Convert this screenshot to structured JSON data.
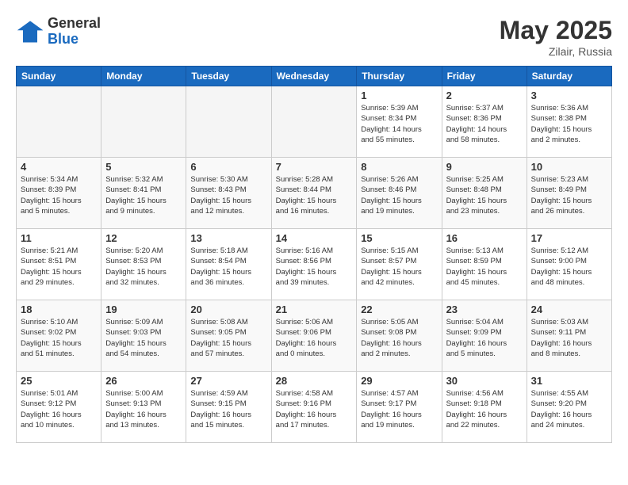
{
  "header": {
    "logo_general": "General",
    "logo_blue": "Blue",
    "month_year": "May 2025",
    "location": "Zilair, Russia"
  },
  "weekdays": [
    "Sunday",
    "Monday",
    "Tuesday",
    "Wednesday",
    "Thursday",
    "Friday",
    "Saturday"
  ],
  "weeks": [
    [
      {
        "day": "",
        "info": ""
      },
      {
        "day": "",
        "info": ""
      },
      {
        "day": "",
        "info": ""
      },
      {
        "day": "",
        "info": ""
      },
      {
        "day": "1",
        "info": "Sunrise: 5:39 AM\nSunset: 8:34 PM\nDaylight: 14 hours\nand 55 minutes."
      },
      {
        "day": "2",
        "info": "Sunrise: 5:37 AM\nSunset: 8:36 PM\nDaylight: 14 hours\nand 58 minutes."
      },
      {
        "day": "3",
        "info": "Sunrise: 5:36 AM\nSunset: 8:38 PM\nDaylight: 15 hours\nand 2 minutes."
      }
    ],
    [
      {
        "day": "4",
        "info": "Sunrise: 5:34 AM\nSunset: 8:39 PM\nDaylight: 15 hours\nand 5 minutes."
      },
      {
        "day": "5",
        "info": "Sunrise: 5:32 AM\nSunset: 8:41 PM\nDaylight: 15 hours\nand 9 minutes."
      },
      {
        "day": "6",
        "info": "Sunrise: 5:30 AM\nSunset: 8:43 PM\nDaylight: 15 hours\nand 12 minutes."
      },
      {
        "day": "7",
        "info": "Sunrise: 5:28 AM\nSunset: 8:44 PM\nDaylight: 15 hours\nand 16 minutes."
      },
      {
        "day": "8",
        "info": "Sunrise: 5:26 AM\nSunset: 8:46 PM\nDaylight: 15 hours\nand 19 minutes."
      },
      {
        "day": "9",
        "info": "Sunrise: 5:25 AM\nSunset: 8:48 PM\nDaylight: 15 hours\nand 23 minutes."
      },
      {
        "day": "10",
        "info": "Sunrise: 5:23 AM\nSunset: 8:49 PM\nDaylight: 15 hours\nand 26 minutes."
      }
    ],
    [
      {
        "day": "11",
        "info": "Sunrise: 5:21 AM\nSunset: 8:51 PM\nDaylight: 15 hours\nand 29 minutes."
      },
      {
        "day": "12",
        "info": "Sunrise: 5:20 AM\nSunset: 8:53 PM\nDaylight: 15 hours\nand 32 minutes."
      },
      {
        "day": "13",
        "info": "Sunrise: 5:18 AM\nSunset: 8:54 PM\nDaylight: 15 hours\nand 36 minutes."
      },
      {
        "day": "14",
        "info": "Sunrise: 5:16 AM\nSunset: 8:56 PM\nDaylight: 15 hours\nand 39 minutes."
      },
      {
        "day": "15",
        "info": "Sunrise: 5:15 AM\nSunset: 8:57 PM\nDaylight: 15 hours\nand 42 minutes."
      },
      {
        "day": "16",
        "info": "Sunrise: 5:13 AM\nSunset: 8:59 PM\nDaylight: 15 hours\nand 45 minutes."
      },
      {
        "day": "17",
        "info": "Sunrise: 5:12 AM\nSunset: 9:00 PM\nDaylight: 15 hours\nand 48 minutes."
      }
    ],
    [
      {
        "day": "18",
        "info": "Sunrise: 5:10 AM\nSunset: 9:02 PM\nDaylight: 15 hours\nand 51 minutes."
      },
      {
        "day": "19",
        "info": "Sunrise: 5:09 AM\nSunset: 9:03 PM\nDaylight: 15 hours\nand 54 minutes."
      },
      {
        "day": "20",
        "info": "Sunrise: 5:08 AM\nSunset: 9:05 PM\nDaylight: 15 hours\nand 57 minutes."
      },
      {
        "day": "21",
        "info": "Sunrise: 5:06 AM\nSunset: 9:06 PM\nDaylight: 16 hours\nand 0 minutes."
      },
      {
        "day": "22",
        "info": "Sunrise: 5:05 AM\nSunset: 9:08 PM\nDaylight: 16 hours\nand 2 minutes."
      },
      {
        "day": "23",
        "info": "Sunrise: 5:04 AM\nSunset: 9:09 PM\nDaylight: 16 hours\nand 5 minutes."
      },
      {
        "day": "24",
        "info": "Sunrise: 5:03 AM\nSunset: 9:11 PM\nDaylight: 16 hours\nand 8 minutes."
      }
    ],
    [
      {
        "day": "25",
        "info": "Sunrise: 5:01 AM\nSunset: 9:12 PM\nDaylight: 16 hours\nand 10 minutes."
      },
      {
        "day": "26",
        "info": "Sunrise: 5:00 AM\nSunset: 9:13 PM\nDaylight: 16 hours\nand 13 minutes."
      },
      {
        "day": "27",
        "info": "Sunrise: 4:59 AM\nSunset: 9:15 PM\nDaylight: 16 hours\nand 15 minutes."
      },
      {
        "day": "28",
        "info": "Sunrise: 4:58 AM\nSunset: 9:16 PM\nDaylight: 16 hours\nand 17 minutes."
      },
      {
        "day": "29",
        "info": "Sunrise: 4:57 AM\nSunset: 9:17 PM\nDaylight: 16 hours\nand 19 minutes."
      },
      {
        "day": "30",
        "info": "Sunrise: 4:56 AM\nSunset: 9:18 PM\nDaylight: 16 hours\nand 22 minutes."
      },
      {
        "day": "31",
        "info": "Sunrise: 4:55 AM\nSunset: 9:20 PM\nDaylight: 16 hours\nand 24 minutes."
      }
    ]
  ]
}
